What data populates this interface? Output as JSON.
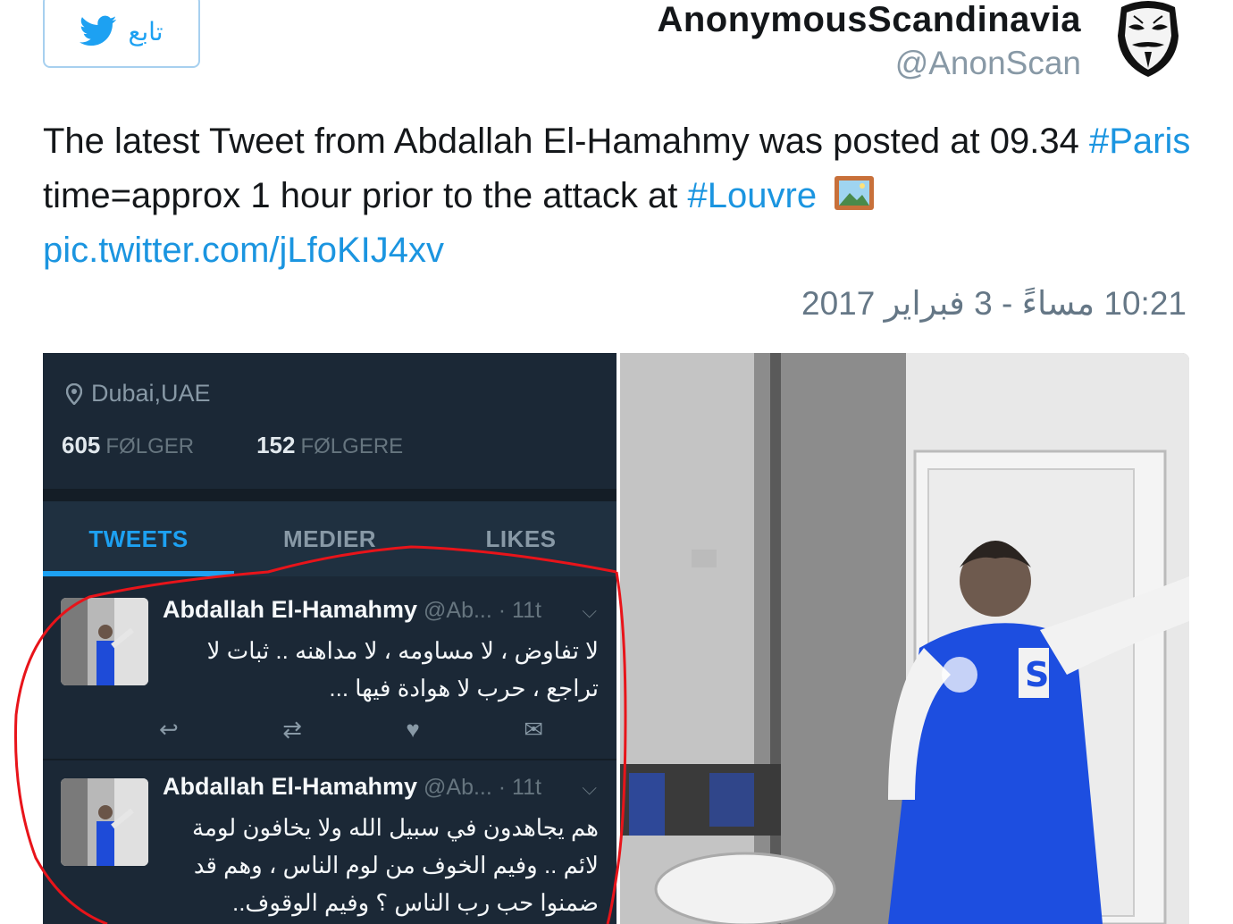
{
  "header": {
    "follow_label": "تابع",
    "display_name": "AnonymousScandinavia",
    "handle": "@AnonScan"
  },
  "tweet": {
    "text_part1": "The latest Tweet from Abdallah El-Hamahmy was posted at 09.34 ",
    "hashtag_paris": "#Paris",
    "text_part2": " time=approx 1 hour prior to the attack at ",
    "hashtag_louvre": "#Louvre",
    "pic_link": "pic.twitter.com/jLfoKIJ4xv",
    "timestamp": "10:21 مساءً - 3 فبراير 2017"
  },
  "screenshot_profile": {
    "location": "Dubai,UAE",
    "following_count": "605",
    "following_label": "FØLGER",
    "followers_count": "152",
    "followers_label": "FØLGERE",
    "tabs": [
      {
        "label": "TWEETS",
        "active": true
      },
      {
        "label": "MEDIER",
        "active": false
      },
      {
        "label": "LIKES",
        "active": false
      }
    ],
    "tweets": [
      {
        "name": "Abdallah El-Hamahmy",
        "meta": " @Ab... · 11t",
        "text": "لا تفاوض ، لا مساومه ، لا مداهنه .. ثبات لا تراجع ، حرب لا هوادة فيها ..."
      },
      {
        "name": "Abdallah El-Hamahmy",
        "meta": " @Ab... · 11t",
        "text": "هم يجاهدون في سبيل الله ولا يخافون لومة لائم .. وفيم الخوف من لوم الناس ، وهم قد ضمنوا حب رب الناس ؟ وفيم الوقوف.."
      }
    ]
  },
  "colors": {
    "link": "#1b95e0",
    "twitter_blue": "#1da1f2",
    "dark_bg": "#1b2836",
    "annotation_red": "#e8141a"
  },
  "icons": {
    "follow": "twitter-bird-icon",
    "location": "location-pin-icon",
    "reply": "reply-icon",
    "retweet": "retweet-icon",
    "like": "heart-icon",
    "dm": "envelope-icon",
    "more": "chevron-down-icon"
  }
}
